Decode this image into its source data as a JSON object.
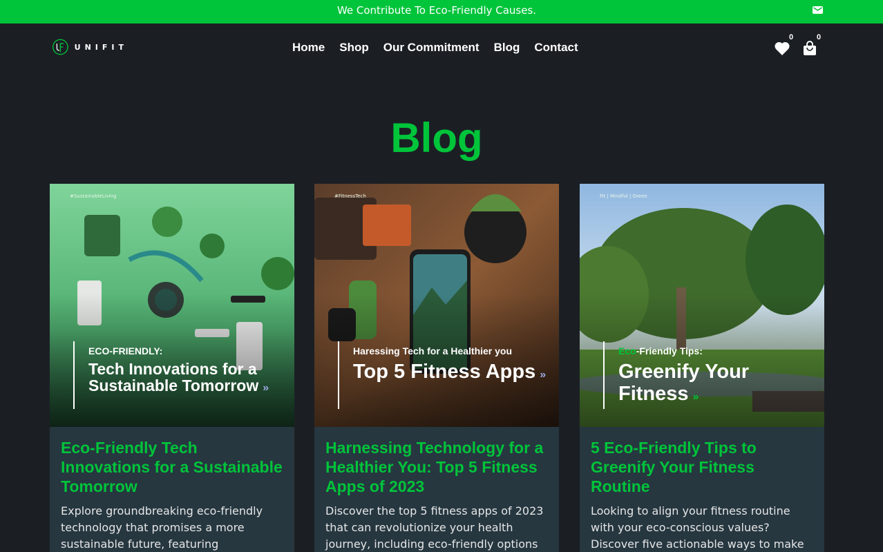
{
  "topbar": {
    "text": "We Contribute To Eco-Friendly Causes.",
    "icon": "mail-icon"
  },
  "logo": {
    "text": "UNIFIT"
  },
  "nav": {
    "items": [
      "Home",
      "Shop",
      "Our Commitment",
      "Blog",
      "Contact"
    ]
  },
  "header_icons": {
    "wishlist_count": "0",
    "cart_count": "0"
  },
  "page": {
    "title": "Blog"
  },
  "colors": {
    "accent": "#00c43a",
    "background": "#1b1f24",
    "card": "#263740"
  },
  "posts": [
    {
      "tag": "#SustainableLiving",
      "overlay_kicker": "ECO-FRIENDLY:",
      "overlay_title": "Tech Innovations for a Sustainable Tomorrow",
      "title": "Eco-Friendly Tech Innovations for a Sustainable Tomorrow",
      "excerpt": "Explore groundbreaking eco-friendly technology that promises a more sustainable future, featuring"
    },
    {
      "tag": "#FitnessTech",
      "overlay_kicker": "Haressing Tech for a Healthier you",
      "overlay_title": "Top 5 Fitness Apps",
      "title": "Harnessing Technology for a Healthier You: Top 5 Fitness Apps of 2023",
      "excerpt": "Discover the top 5 fitness apps of 2023 that can revolutionize your health journey, including eco-friendly options"
    },
    {
      "tag": "Fit | Mindful | Green",
      "overlay_kicker_green": "Eco",
      "overlay_kicker": "-Friendly Tips:",
      "overlay_title": "Greenify Your Fitness",
      "title": "5 Eco-Friendly Tips to Greenify Your Fitness Routine",
      "excerpt": "Looking to align your fitness routine with your eco-conscious values? Discover five actionable ways to make"
    }
  ]
}
